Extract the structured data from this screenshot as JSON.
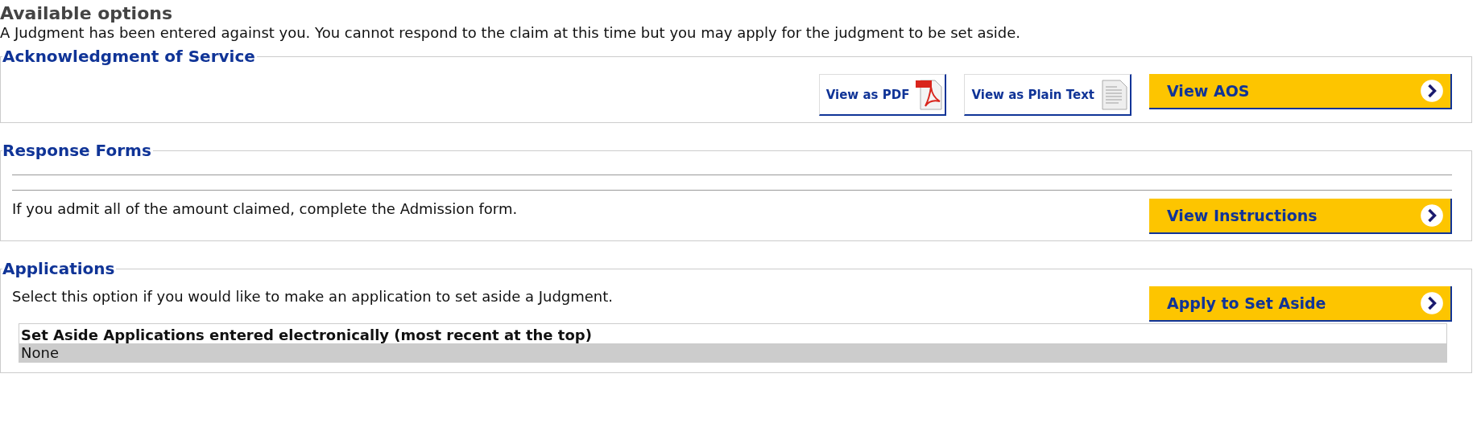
{
  "title": "Available options",
  "intro": "A Judgment has been entered against you. You cannot respond to the claim at this time but you may apply for the judgment to be set aside.",
  "sections": [
    {
      "kind": "documents",
      "legend": "Acknowledgment of Service",
      "buttons": [
        {
          "kind": "pdf",
          "label": "View as PDF"
        },
        {
          "kind": "plain",
          "label": "View as Plain Text"
        },
        {
          "kind": "primary",
          "label": "View AOS"
        }
      ]
    },
    {
      "kind": "forms",
      "legend": "Response Forms",
      "text": "If you admit all of the amount claimed, complete the Admission form.",
      "buttons": [
        {
          "kind": "primary",
          "label": "View Instructions"
        }
      ]
    },
    {
      "kind": "applications",
      "legend": "Applications",
      "text": "Select this option if you would like to make an application to set aside a Judgment.",
      "buttons": [
        {
          "kind": "primary",
          "label": "Apply to Set Aside"
        }
      ],
      "table": {
        "heading": "Set Aside Applications entered electronically (most recent at the top)",
        "rows": [
          "None"
        ]
      }
    }
  ]
}
